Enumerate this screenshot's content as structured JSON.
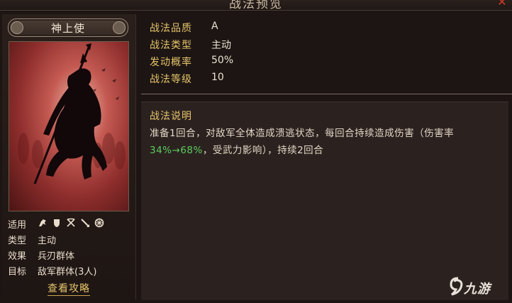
{
  "window": {
    "title": "战法预览",
    "close_icon": "close-icon"
  },
  "general": {
    "name": "神上使",
    "attributes": [
      {
        "label": "适用",
        "icons": [
          "cavalry-icon",
          "shield-icon",
          "crossbow-icon",
          "spear-icon",
          "siege-icon"
        ]
      },
      {
        "label": "类型",
        "value": "主动"
      },
      {
        "label": "效果",
        "value": "兵刃群体"
      },
      {
        "label": "目标",
        "value": "敌军群体(3人)"
      }
    ],
    "guide_link": "查看攻略"
  },
  "tactic": {
    "quality_label": "战法品质",
    "quality_value": "A",
    "type_label": "战法类型",
    "type_value": "主动",
    "rate_label": "发动概率",
    "rate_value": "50%",
    "level_label": "战法等级",
    "level_value": "10"
  },
  "description": {
    "title": "战法说明",
    "text_part1": "准备1回合，对敌军全体造成溃逃状态，每回合持续造成伤害（伤害率",
    "text_highlight": "34%→68%",
    "text_part2": "，受武力影响），持续2回合"
  },
  "colors": {
    "accent": "#e6c46a",
    "highlight": "#5ccb5c"
  },
  "watermark": {
    "logo_icon": "jiuyou-logo-icon",
    "text": "九游"
  }
}
